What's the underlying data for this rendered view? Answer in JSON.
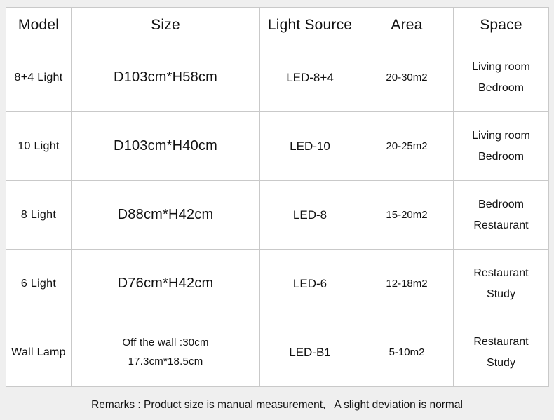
{
  "table": {
    "headers": [
      {
        "key": "model",
        "label": "Model"
      },
      {
        "key": "size",
        "label": "Size"
      },
      {
        "key": "light_source",
        "label": "Light Source"
      },
      {
        "key": "area",
        "label": "Area"
      },
      {
        "key": "space",
        "label": "Space"
      }
    ],
    "rows": [
      {
        "model": "8+4  Light",
        "size_lines": [
          "D103cm*H58cm"
        ],
        "light_source": "LED-8+4",
        "area": "20-30m2",
        "space_lines": [
          "Living room",
          "Bedroom"
        ]
      },
      {
        "model": "10  Light",
        "size_lines": [
          "D103cm*H40cm"
        ],
        "light_source": "LED-10",
        "area": "20-25m2",
        "space_lines": [
          "Living room",
          "Bedroom"
        ]
      },
      {
        "model": "8  Light",
        "size_lines": [
          "D88cm*H42cm"
        ],
        "light_source": "LED-8",
        "area": "15-20m2",
        "space_lines": [
          "Bedroom",
          "Restaurant"
        ]
      },
      {
        "model": "6  Light",
        "size_lines": [
          "D76cm*H42cm"
        ],
        "light_source": "LED-6",
        "area": "12-18m2",
        "space_lines": [
          "Restaurant",
          "Study"
        ]
      },
      {
        "model": "Wall  Lamp",
        "size_lines": [
          "Off the wall :30cm",
          "17.3cm*18.5cm"
        ],
        "light_source": "LED-B1",
        "area": "5-10m2",
        "space_lines": [
          "Restaurant",
          "Study"
        ]
      }
    ]
  },
  "footer": {
    "remarks": "Remarks : Product size is manual measurement,   A slight deviation is normal"
  },
  "colors": {
    "page_background": "#efefef",
    "cell_background": "#ffffff",
    "border": "#c9c9c9",
    "text": "#111111"
  }
}
